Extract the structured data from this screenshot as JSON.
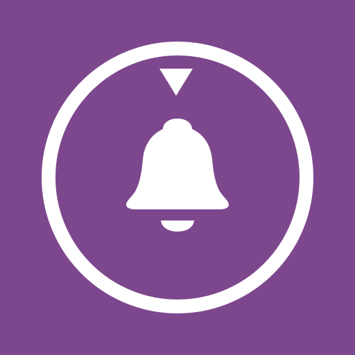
{
  "icon": {
    "name": "bell-alert-icon",
    "parts": [
      "ring-icon",
      "down-arrow-icon",
      "bell-icon",
      "bell-clapper-icon"
    ]
  },
  "colors": {
    "background": "#7d478d",
    "foreground": "#ffffff"
  }
}
